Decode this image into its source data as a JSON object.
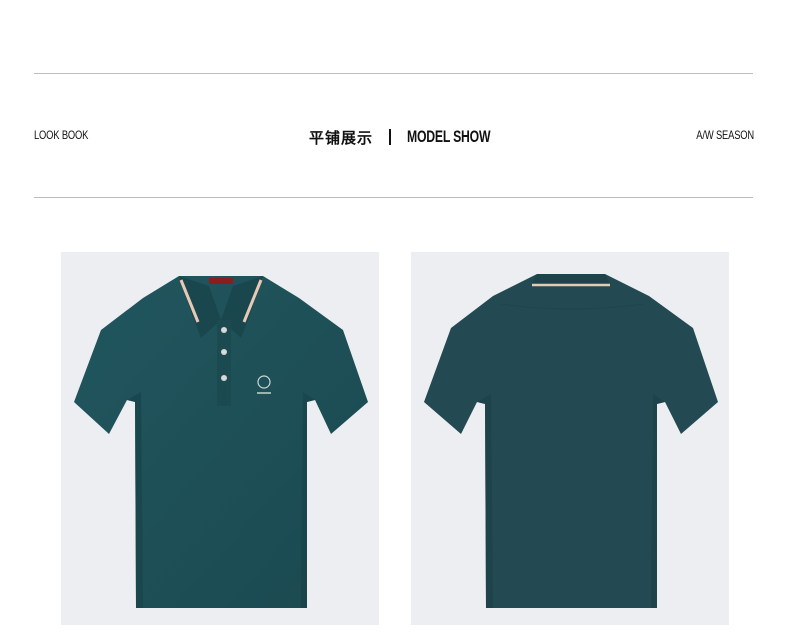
{
  "header": {
    "left_label": "LOOK BOOK",
    "center_cn": "平铺展示",
    "center_en": "MODEL SHOW",
    "right_label": "A/W SEASON"
  },
  "colors": {
    "background": "#ffffff",
    "rule": "#bdbdbd",
    "photo_bg": "#eceef1",
    "shirt": "#1f4f57",
    "shirt_back": "#234a52",
    "collar_trim": "#e7c9b5"
  },
  "images": [
    {
      "name": "front",
      "content": "teal polo shirt front view"
    },
    {
      "name": "back",
      "content": "teal polo shirt back view"
    }
  ]
}
